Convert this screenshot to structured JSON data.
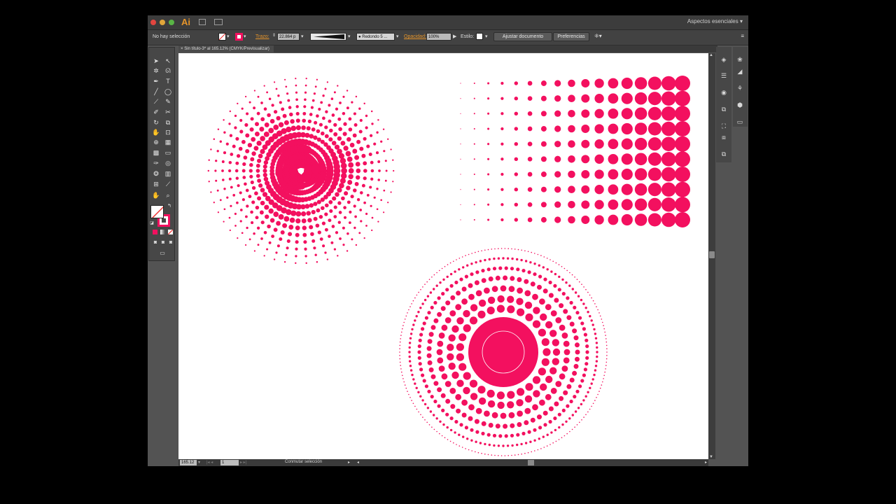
{
  "app": {
    "logo": "Ai",
    "workspace": "Aspectos esenciales"
  },
  "controlbar": {
    "selection_status": "No hay selección",
    "stroke_label": "Trazo:",
    "stroke_value": "22.864 p",
    "brush_value": "Redondo 5 ...",
    "opacity_label": "Opacidad:",
    "opacity_value": "100%",
    "style_label": "Estilo:",
    "fit_document_button": "Ajustar documento",
    "preferences_button": "Preferencias"
  },
  "document": {
    "tab_title": "Sin título-3* al 165.12% (CMYK/Previsualizar)",
    "tab_close": "×"
  },
  "status": {
    "zoom": "165.12",
    "artboard": "1",
    "status_text": "Conmutar selección"
  },
  "colors": {
    "accent": "#f3105f",
    "fill": "#ffffff",
    "stroke": "#f3105f",
    "ui_dark": "#535353"
  }
}
